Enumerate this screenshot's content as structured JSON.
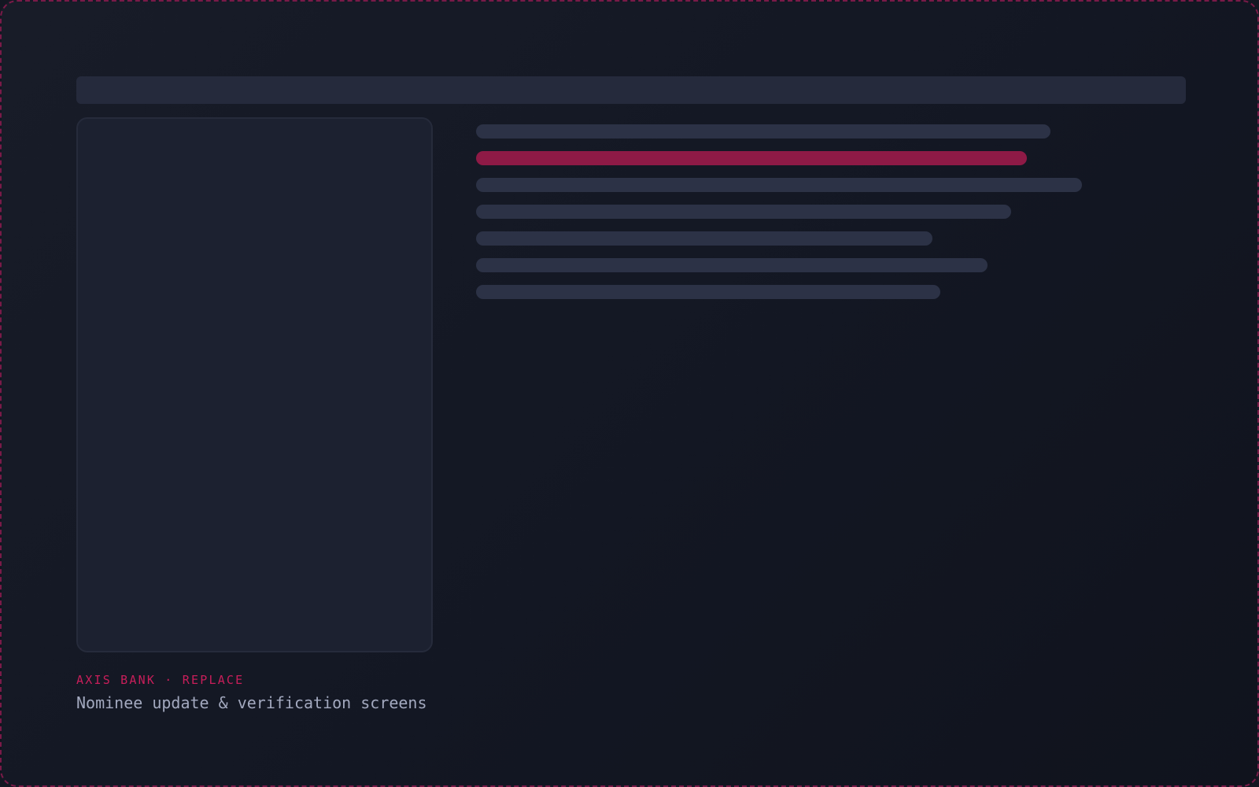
{
  "caption": {
    "kicker": "AXIS BANK · REPLACE",
    "title": "Nominee update & verification screens"
  },
  "placeholder_lines": [
    {
      "fill": 0.73,
      "highlighted": false
    },
    {
      "fill": 0.7,
      "highlighted": true
    },
    {
      "fill": 0.77,
      "highlighted": false
    },
    {
      "fill": 0.68,
      "highlighted": false
    },
    {
      "fill": 0.58,
      "highlighted": false
    },
    {
      "fill": 0.65,
      "highlighted": false
    },
    {
      "fill": 0.59,
      "highlighted": false
    }
  ],
  "colors": {
    "accent": "#c81e5a",
    "highlight_bar": "#8e1a46",
    "placeholder_bar": "#2c3246",
    "frame_border": "#7a1a48"
  }
}
